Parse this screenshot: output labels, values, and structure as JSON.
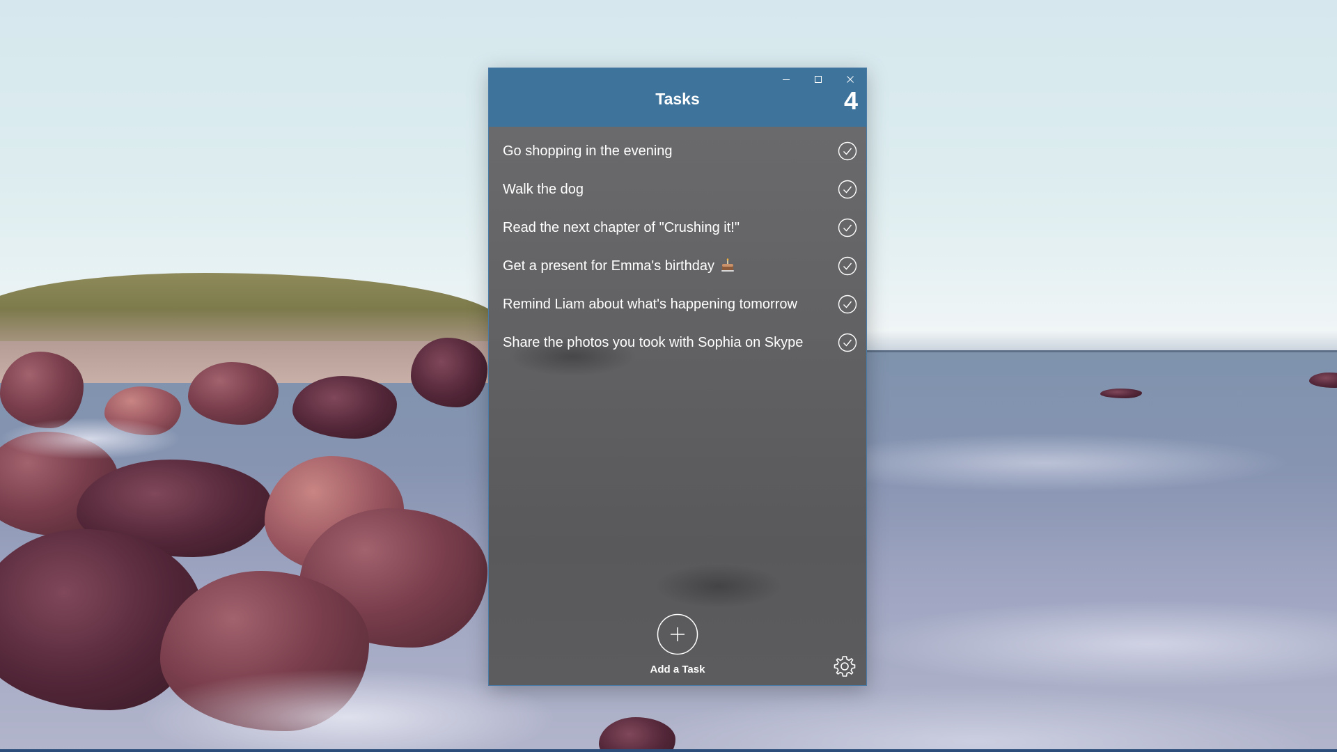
{
  "window": {
    "title": "Tasks",
    "task_count": "4",
    "caption_buttons": [
      "minimize",
      "maximize",
      "close"
    ]
  },
  "tasks": [
    {
      "text": "Go shopping in the evening"
    },
    {
      "text": "Walk the dog"
    },
    {
      "text": "Read the next chapter of \"Crushing it!\""
    },
    {
      "text": "Get a present for Emma's birthday",
      "emoji": "birthday-cake-icon"
    },
    {
      "text": "Remind Liam about what's happening tomorrow"
    },
    {
      "text": "Share the photos you took with Sophia on Skype"
    }
  ],
  "add_task": {
    "label": "Add a Task",
    "icon": "plus-icon"
  },
  "settings": {
    "icon": "gear-icon"
  },
  "colors": {
    "titlebar": "#3e739b",
    "body": "#616163",
    "text": "#ffffff"
  }
}
